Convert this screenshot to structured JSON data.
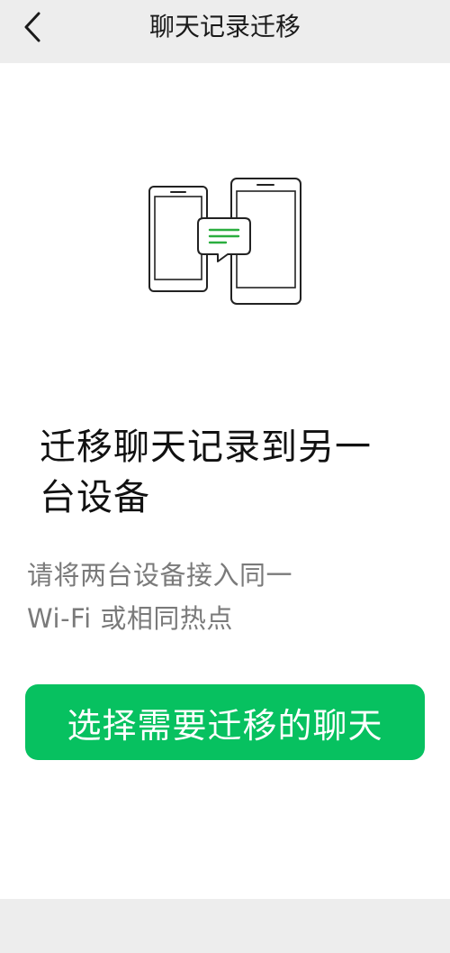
{
  "header": {
    "title": "聊天记录迁移",
    "back_icon": "chevron-left-icon"
  },
  "illustration": {
    "icon": "phones-transfer-chat-icon",
    "accent": "#2aae3f"
  },
  "main": {
    "heading_line1": "迁移聊天记录到另一",
    "heading_line2": "台设备",
    "description_line1": "请将两台设备接入同一",
    "description_line2": "Wi-Fi 或相同热点",
    "button_label": "选择需要迁移的聊天"
  },
  "colors": {
    "primary": "#07c160",
    "header_bg": "#ededed",
    "body_bg": "#ffffff",
    "text_primary": "#111111",
    "text_secondary": "#7a7a7a"
  }
}
